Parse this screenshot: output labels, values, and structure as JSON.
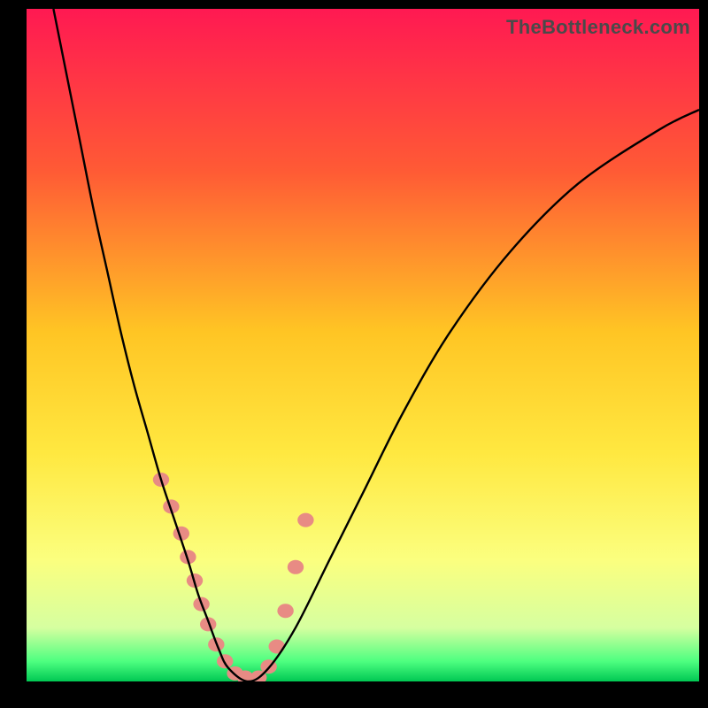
{
  "watermark": "TheBottleneck.com",
  "chart_data": {
    "type": "line",
    "title": "",
    "xlabel": "",
    "ylabel": "",
    "xlim": [
      0,
      100
    ],
    "ylim": [
      0,
      100
    ],
    "grid": false,
    "legend": false,
    "gradient_colors": [
      "#ff1952",
      "#ff6b30",
      "#ffc524",
      "#ffe840",
      "#fbff7f",
      "#a2ff8a",
      "#00c853"
    ],
    "series": [
      {
        "name": "bottleneck-curve",
        "color": "#000000",
        "stroke_width": 2.4,
        "x": [
          4,
          6,
          8,
          10,
          12,
          14,
          16,
          18,
          20,
          22,
          24,
          25.5,
          27,
          28.5,
          30,
          33,
          36,
          40,
          45,
          50,
          56,
          63,
          72,
          82,
          94,
          100
        ],
        "y": [
          100,
          90,
          80,
          70,
          61,
          52,
          44,
          37,
          30,
          24,
          18,
          13,
          9,
          5,
          2,
          0,
          2,
          8,
          18,
          28,
          40,
          52,
          64,
          74,
          82,
          85
        ]
      }
    ],
    "markers": {
      "name": "highlight-dots",
      "color": "#e88b84",
      "radius_px": 8,
      "points_x": [
        20,
        21.5,
        23,
        24,
        25,
        26,
        27,
        28.2,
        29.5,
        31,
        32.5,
        34.5,
        36,
        37.2,
        38.5,
        40,
        41.5
      ],
      "points_y": [
        30,
        26,
        22,
        18.5,
        15,
        11.5,
        8.5,
        5.5,
        3,
        1.2,
        0.6,
        0.6,
        2.2,
        5.2,
        10.5,
        17,
        24
      ]
    },
    "green_band": {
      "y_start": 0,
      "y_end": 3,
      "color": "#00c853"
    }
  }
}
